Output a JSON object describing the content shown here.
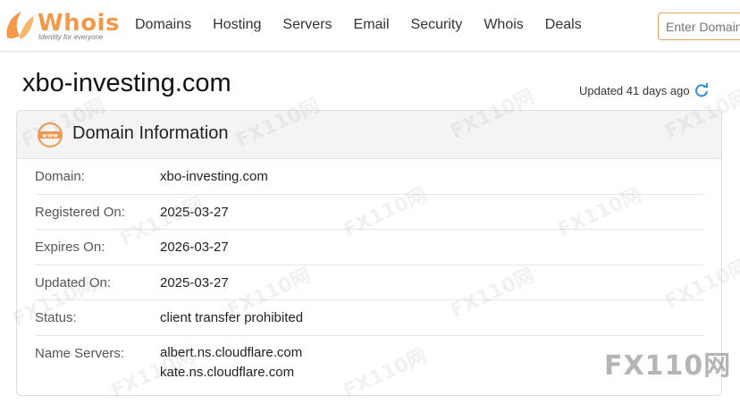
{
  "logo": {
    "name": "Whois",
    "tagline": "Identity for everyone"
  },
  "nav": {
    "items": [
      "Domains",
      "Hosting",
      "Servers",
      "Email",
      "Security",
      "Whois",
      "Deals"
    ]
  },
  "search": {
    "placeholder": "Enter Domain"
  },
  "page": {
    "domain": "xbo-investing.com",
    "updated": "Updated 41 days ago"
  },
  "card": {
    "title": "Domain Information",
    "rows": [
      {
        "label": "Domain:",
        "value": "xbo-investing.com"
      },
      {
        "label": "Registered On:",
        "value": "2025-03-27"
      },
      {
        "label": "Expires On:",
        "value": "2026-03-27"
      },
      {
        "label": "Updated On:",
        "value": "2025-03-27"
      },
      {
        "label": "Status:",
        "value": "client transfer prohibited"
      },
      {
        "label": "Name Servers:",
        "values": [
          "albert.ns.cloudflare.com",
          "kate.ns.cloudflare.com"
        ]
      }
    ]
  },
  "watermark": {
    "text": "FX110网"
  },
  "colors": {
    "brand": "#f2994a",
    "refresh": "#2f8fd8",
    "search_border": "#e6a15c"
  }
}
